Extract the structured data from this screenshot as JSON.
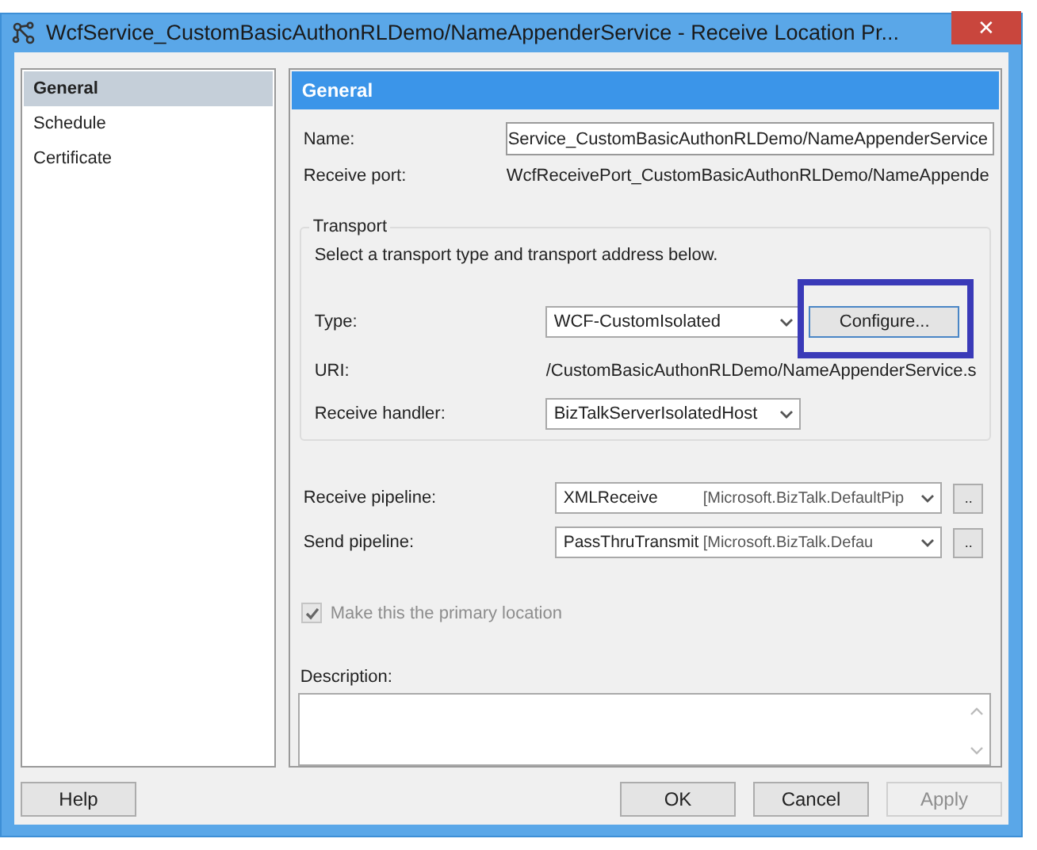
{
  "window": {
    "title": "WcfService_CustomBasicAuthonRLDemo/NameAppenderService - Receive Location Pr...",
    "close": "✕"
  },
  "sidebar": {
    "items": [
      {
        "label": "General",
        "selected": true
      },
      {
        "label": "Schedule",
        "selected": false
      },
      {
        "label": "Certificate",
        "selected": false
      }
    ]
  },
  "panel": {
    "header": "General",
    "name": {
      "label": "Name:",
      "value": "Service_CustomBasicAuthonRLDemo/NameAppenderService"
    },
    "receive_port": {
      "label": "Receive port:",
      "value": "WcfReceivePort_CustomBasicAuthonRLDemo/NameAppende"
    },
    "transport": {
      "legend": "Transport",
      "hint": "Select a transport type and transport address below.",
      "type": {
        "label": "Type:",
        "value": "WCF-CustomIsolated"
      },
      "configure": {
        "label": "Configure...",
        "highlighted": true
      },
      "uri": {
        "label": "URI:",
        "value": "/CustomBasicAuthonRLDemo/NameAppenderService.s"
      },
      "handler": {
        "label": "Receive handler:",
        "value": "BizTalkServerIsolatedHost"
      }
    },
    "pipelines": [
      {
        "label": "Receive pipeline:",
        "value": "XMLReceive",
        "assembly": "[Microsoft.BizTalk.DefaultPip",
        "more": ".."
      },
      {
        "label": "Send pipeline:",
        "value": "PassThruTransmit",
        "assembly": "[Microsoft.BizTalk.Defau",
        "more": ".."
      }
    ],
    "primary": {
      "label": "Make this the primary location",
      "checked": true,
      "disabled": true
    },
    "description": {
      "label": "Description:"
    }
  },
  "buttons": [
    {
      "label": "Help",
      "disabled": false
    },
    {
      "label": "OK",
      "disabled": false
    },
    {
      "label": "Cancel",
      "disabled": false
    },
    {
      "label": "Apply",
      "disabled": true
    }
  ]
}
